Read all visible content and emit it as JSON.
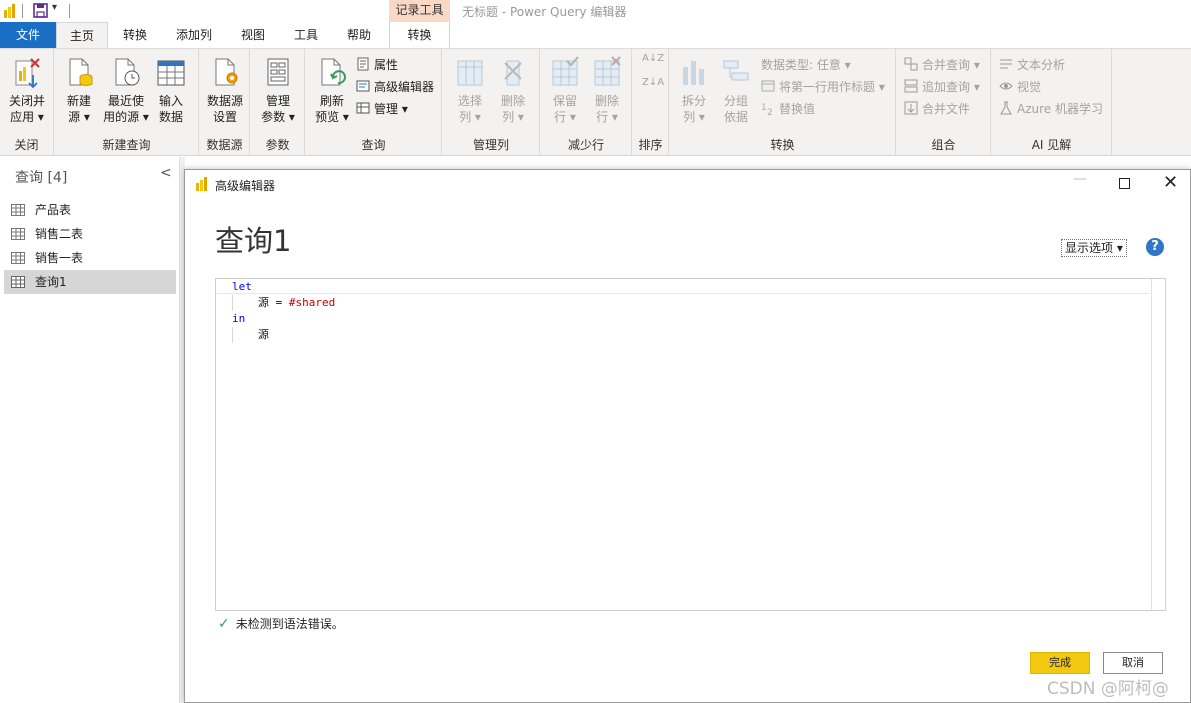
{
  "app": {
    "window_title": "无标题 - Power Query 编辑器",
    "context_tool_group": "记录工具"
  },
  "tabs": [
    {
      "label": "文件"
    },
    {
      "label": "主页"
    },
    {
      "label": "转换"
    },
    {
      "label": "添加列"
    },
    {
      "label": "视图"
    },
    {
      "label": "工具"
    },
    {
      "label": "帮助"
    },
    {
      "label": "转换"
    }
  ],
  "ribbon": {
    "close": {
      "group": "关闭",
      "apply_l1": "关闭并",
      "apply_l2": "应用 ▾"
    },
    "new_query": {
      "group": "新建查询",
      "new_source_l1": "新建",
      "new_source_l2": "源 ▾",
      "recent_l1": "最近使",
      "recent_l2": "用的源 ▾",
      "enter_l1": "输入",
      "enter_l2": "数据"
    },
    "data_source": {
      "group": "数据源",
      "settings_l1": "数据源",
      "settings_l2": "设置"
    },
    "params": {
      "group": "参数",
      "manage_l1": "管理",
      "manage_l2": "参数 ▾"
    },
    "query": {
      "group": "查询",
      "refresh_l1": "刷新",
      "refresh_l2": "预览 ▾",
      "properties": "属性",
      "advanced_editor": "高级编辑器",
      "manage": "管理 ▾"
    },
    "manage_columns": {
      "group": "管理列",
      "choose_l1": "选择",
      "choose_l2": "列 ▾",
      "remove_l1": "删除",
      "remove_l2": "列 ▾"
    },
    "reduce_rows": {
      "group": "减少行",
      "keep_l1": "保留",
      "keep_l2": "行 ▾",
      "remove_l1": "删除",
      "remove_l2": "行 ▾"
    },
    "sort": {
      "group": "排序",
      "asc": "A↓Z",
      "desc": "Z↓A"
    },
    "transform": {
      "group": "转换",
      "split_l1": "拆分",
      "split_l2": "列 ▾",
      "group_l1": "分组",
      "group_l2": "依据",
      "data_type": "数据类型: 任意 ▾",
      "first_row": "将第一行用作标题 ▾",
      "replace": "替换值"
    },
    "combine": {
      "group": "组合",
      "merge": "合并查询 ▾",
      "append": "追加查询 ▾",
      "combine_files": "合并文件"
    },
    "ai": {
      "group": "AI 见解",
      "text": "文本分析",
      "vision": "视觉",
      "azure_ml": "Azure 机器学习"
    }
  },
  "left_pane": {
    "title": "查询 [4]",
    "queries": [
      {
        "label": "产品表"
      },
      {
        "label": "销售二表"
      },
      {
        "label": "销售一表"
      },
      {
        "label": "查询1"
      }
    ]
  },
  "dialog": {
    "title": "高级编辑器",
    "heading": "查询1",
    "options": "显示选项 ▾",
    "help": "?",
    "code": {
      "let": "let",
      "src_name": "源",
      "equals": " = ",
      "shared": "#shared",
      "in": "in",
      "result": "源"
    },
    "status": "未检测到语法错误。",
    "done": "完成",
    "cancel": "取消"
  },
  "watermark": "CSDN @阿柯@",
  "colors": {
    "accent": "#1a6fc4",
    "primary_button": "#f2c811",
    "context_tab": "#f9d8c6",
    "keyword": "#0000ff",
    "literal": "#c00000",
    "ok_check": "#3a9a5a"
  }
}
